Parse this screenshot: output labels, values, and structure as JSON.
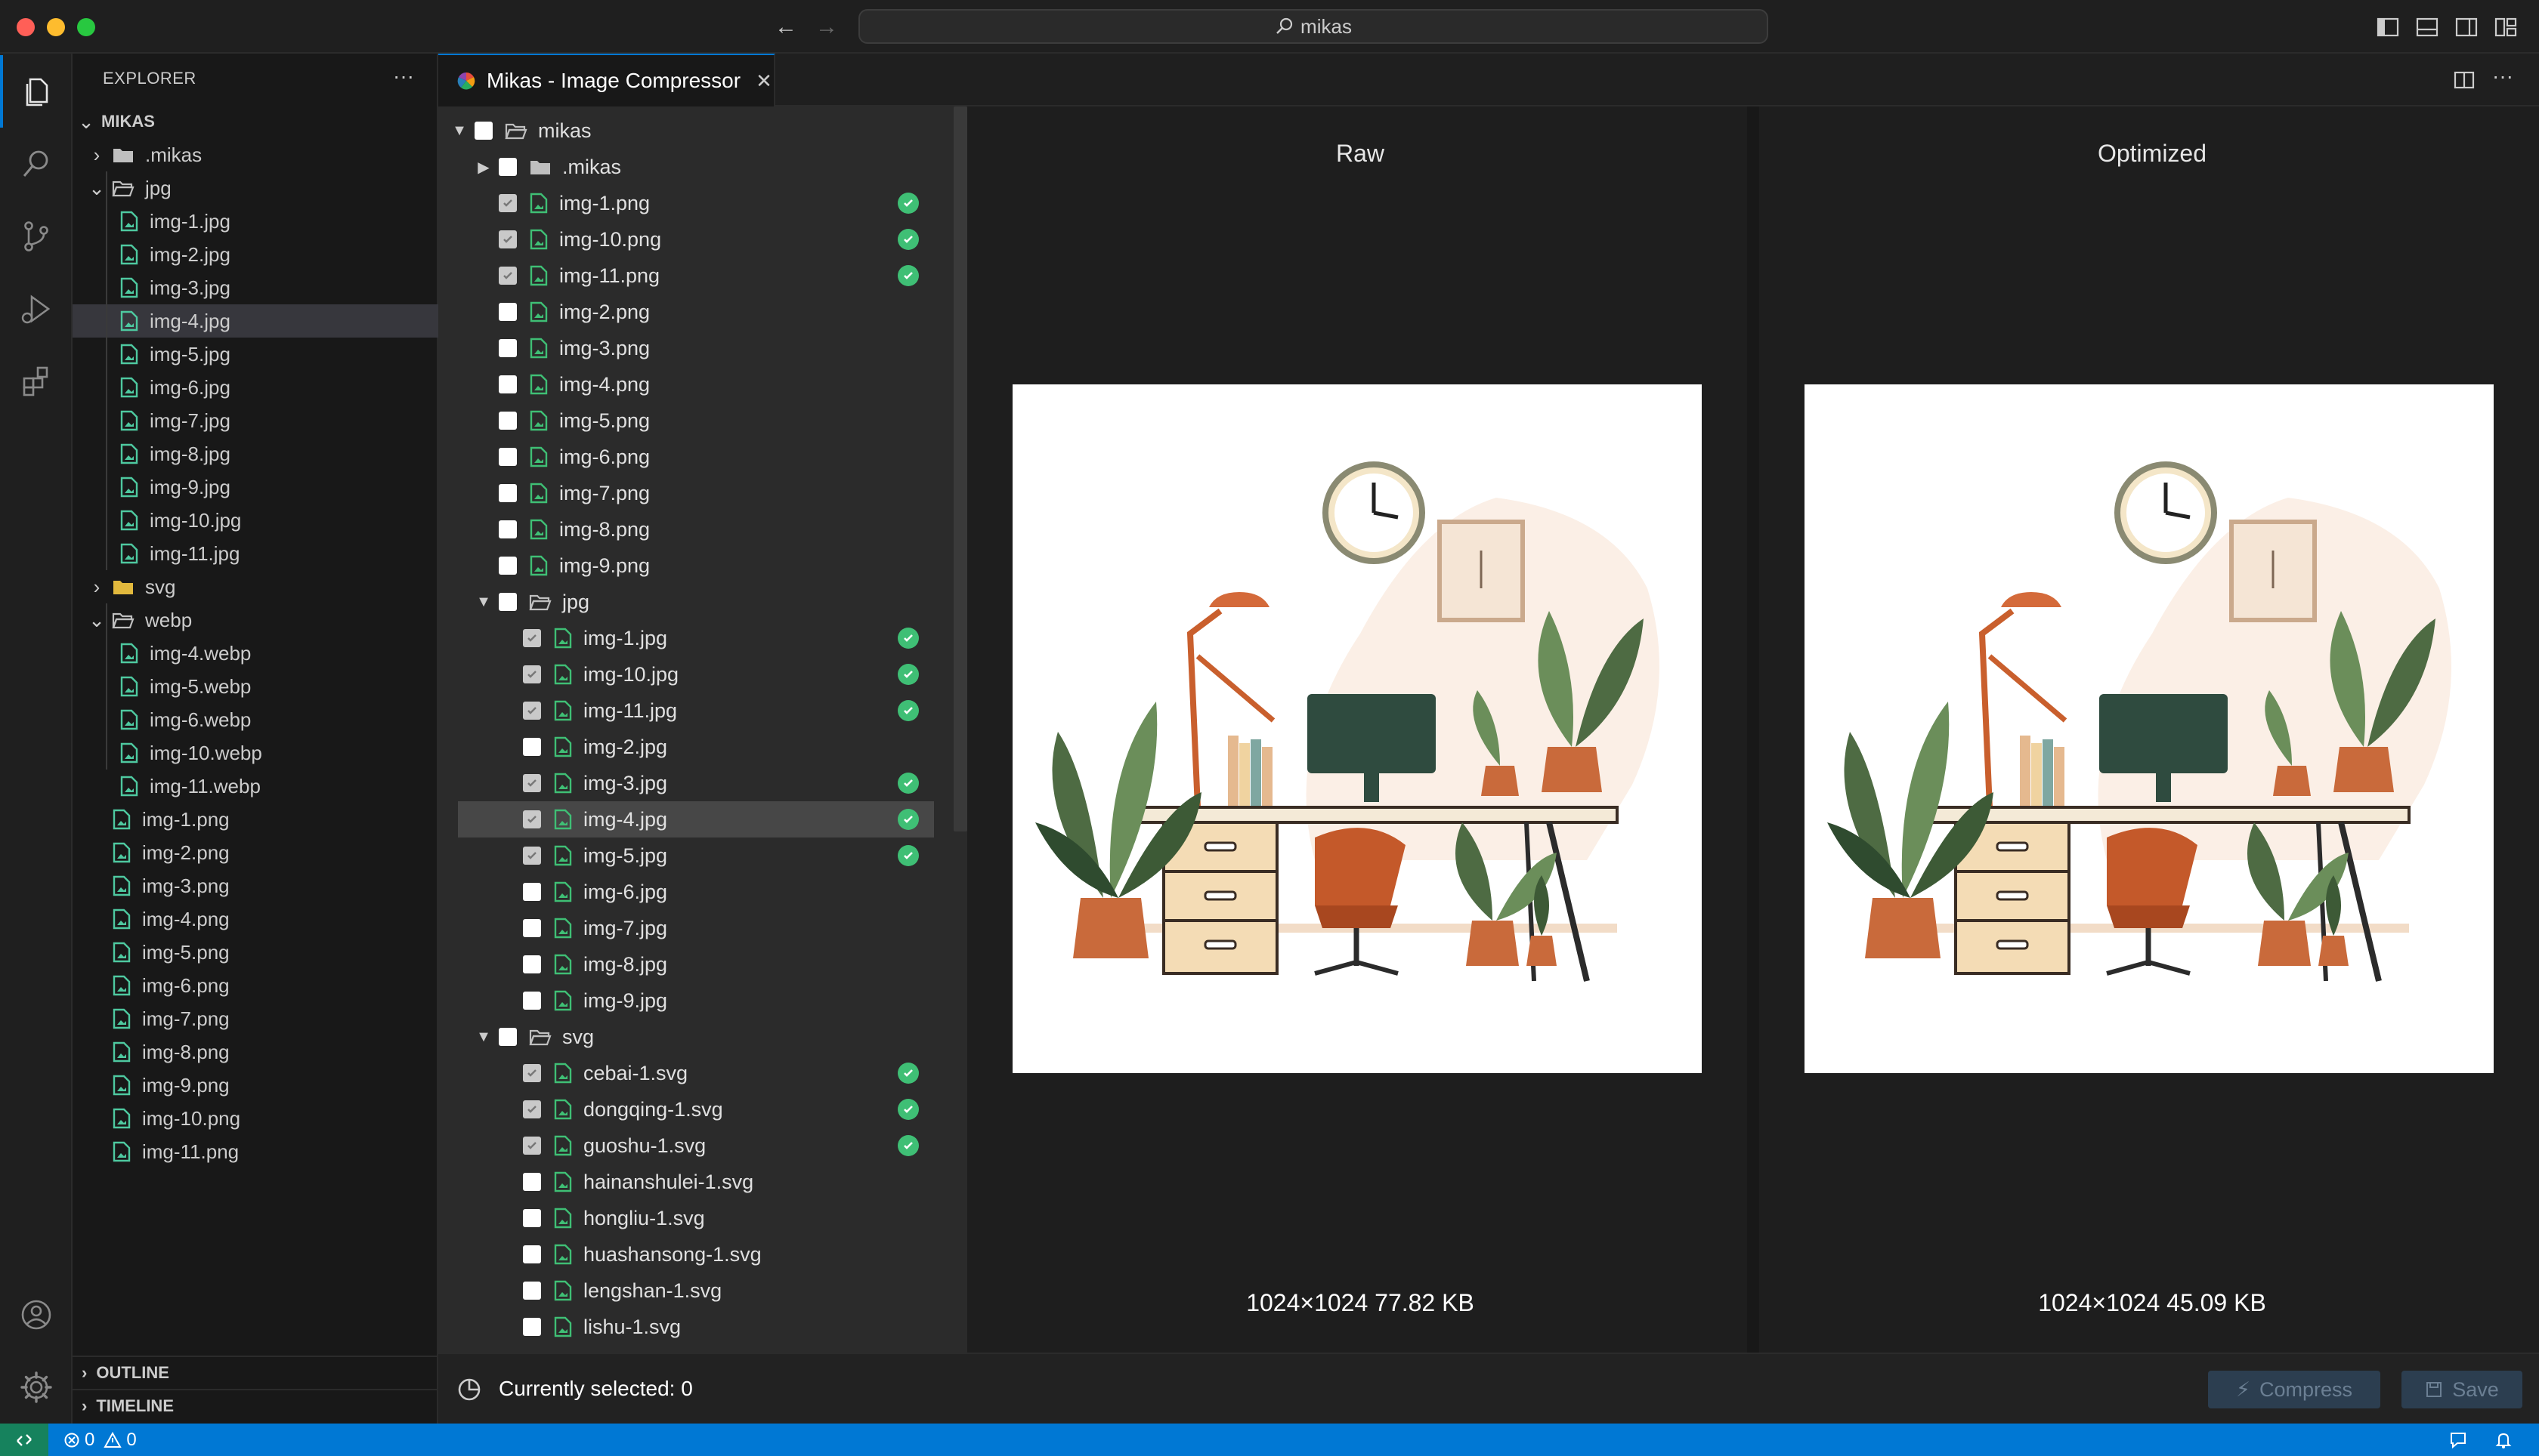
{
  "window": {
    "search_text": "mikas"
  },
  "sidebar": {
    "title": "EXPLORER",
    "root": "MIKAS",
    "items": [
      {
        "label": ".mikas",
        "kind": "folder",
        "depth": 1,
        "expanded": false
      },
      {
        "label": "jpg",
        "kind": "folder",
        "depth": 1,
        "expanded": true
      },
      {
        "label": "img-1.jpg",
        "kind": "file",
        "depth": 2
      },
      {
        "label": "img-2.jpg",
        "kind": "file",
        "depth": 2
      },
      {
        "label": "img-3.jpg",
        "kind": "file",
        "depth": 2
      },
      {
        "label": "img-4.jpg",
        "kind": "file",
        "depth": 2,
        "selected": true
      },
      {
        "label": "img-5.jpg",
        "kind": "file",
        "depth": 2
      },
      {
        "label": "img-6.jpg",
        "kind": "file",
        "depth": 2
      },
      {
        "label": "img-7.jpg",
        "kind": "file",
        "depth": 2
      },
      {
        "label": "img-8.jpg",
        "kind": "file",
        "depth": 2
      },
      {
        "label": "img-9.jpg",
        "kind": "file",
        "depth": 2
      },
      {
        "label": "img-10.jpg",
        "kind": "file",
        "depth": 2
      },
      {
        "label": "img-11.jpg",
        "kind": "file",
        "depth": 2
      },
      {
        "label": "svg",
        "kind": "folder",
        "depth": 1,
        "expanded": false,
        "yellow": true
      },
      {
        "label": "webp",
        "kind": "folder",
        "depth": 1,
        "expanded": true
      },
      {
        "label": "img-4.webp",
        "kind": "file",
        "depth": 2
      },
      {
        "label": "img-5.webp",
        "kind": "file",
        "depth": 2
      },
      {
        "label": "img-6.webp",
        "kind": "file",
        "depth": 2
      },
      {
        "label": "img-10.webp",
        "kind": "file",
        "depth": 2
      },
      {
        "label": "img-11.webp",
        "kind": "file",
        "depth": 2
      },
      {
        "label": "img-1.png",
        "kind": "file",
        "depth": 1
      },
      {
        "label": "img-2.png",
        "kind": "file",
        "depth": 1
      },
      {
        "label": "img-3.png",
        "kind": "file",
        "depth": 1
      },
      {
        "label": "img-4.png",
        "kind": "file",
        "depth": 1
      },
      {
        "label": "img-5.png",
        "kind": "file",
        "depth": 1
      },
      {
        "label": "img-6.png",
        "kind": "file",
        "depth": 1
      },
      {
        "label": "img-7.png",
        "kind": "file",
        "depth": 1
      },
      {
        "label": "img-8.png",
        "kind": "file",
        "depth": 1
      },
      {
        "label": "img-9.png",
        "kind": "file",
        "depth": 1
      },
      {
        "label": "img-10.png",
        "kind": "file",
        "depth": 1
      },
      {
        "label": "img-11.png",
        "kind": "file",
        "depth": 1
      }
    ],
    "outline": "OUTLINE",
    "timeline": "TIMELINE"
  },
  "editor": {
    "tab_title": "Mikas - Image Compressor",
    "files": [
      {
        "label": "mikas",
        "kind": "folder",
        "depth": 0,
        "expanded": true
      },
      {
        "label": ".mikas",
        "kind": "folder",
        "depth": 1,
        "expanded": false
      },
      {
        "label": "img-1.png",
        "kind": "file",
        "depth": 1,
        "checked": true,
        "done": true
      },
      {
        "label": "img-10.png",
        "kind": "file",
        "depth": 1,
        "checked": true,
        "done": true
      },
      {
        "label": "img-11.png",
        "kind": "file",
        "depth": 1,
        "checked": true,
        "done": true
      },
      {
        "label": "img-2.png",
        "kind": "file",
        "depth": 1
      },
      {
        "label": "img-3.png",
        "kind": "file",
        "depth": 1
      },
      {
        "label": "img-4.png",
        "kind": "file",
        "depth": 1
      },
      {
        "label": "img-5.png",
        "kind": "file",
        "depth": 1
      },
      {
        "label": "img-6.png",
        "kind": "file",
        "depth": 1
      },
      {
        "label": "img-7.png",
        "kind": "file",
        "depth": 1
      },
      {
        "label": "img-8.png",
        "kind": "file",
        "depth": 1
      },
      {
        "label": "img-9.png",
        "kind": "file",
        "depth": 1
      },
      {
        "label": "jpg",
        "kind": "folder",
        "depth": 1,
        "expanded": true
      },
      {
        "label": "img-1.jpg",
        "kind": "file",
        "depth": 2,
        "checked": true,
        "done": true
      },
      {
        "label": "img-10.jpg",
        "kind": "file",
        "depth": 2,
        "checked": true,
        "done": true
      },
      {
        "label": "img-11.jpg",
        "kind": "file",
        "depth": 2,
        "checked": true,
        "done": true
      },
      {
        "label": "img-2.jpg",
        "kind": "file",
        "depth": 2
      },
      {
        "label": "img-3.jpg",
        "kind": "file",
        "depth": 2,
        "checked": true,
        "done": true
      },
      {
        "label": "img-4.jpg",
        "kind": "file",
        "depth": 2,
        "checked": true,
        "done": true,
        "selected": true
      },
      {
        "label": "img-5.jpg",
        "kind": "file",
        "depth": 2,
        "checked": true,
        "done": true
      },
      {
        "label": "img-6.jpg",
        "kind": "file",
        "depth": 2
      },
      {
        "label": "img-7.jpg",
        "kind": "file",
        "depth": 2
      },
      {
        "label": "img-8.jpg",
        "kind": "file",
        "depth": 2
      },
      {
        "label": "img-9.jpg",
        "kind": "file",
        "depth": 2
      },
      {
        "label": "svg",
        "kind": "folder",
        "depth": 1,
        "expanded": true
      },
      {
        "label": "cebai-1.svg",
        "kind": "file",
        "depth": 2,
        "checked": true,
        "done": true
      },
      {
        "label": "dongqing-1.svg",
        "kind": "file",
        "depth": 2,
        "checked": true,
        "done": true
      },
      {
        "label": "guoshu-1.svg",
        "kind": "file",
        "depth": 2,
        "checked": true,
        "done": true
      },
      {
        "label": "hainanshulei-1.svg",
        "kind": "file",
        "depth": 2
      },
      {
        "label": "hongliu-1.svg",
        "kind": "file",
        "depth": 2
      },
      {
        "label": "huashansong-1.svg",
        "kind": "file",
        "depth": 2
      },
      {
        "label": "lengshan-1.svg",
        "kind": "file",
        "depth": 2
      },
      {
        "label": "lishu-1.svg",
        "kind": "file",
        "depth": 2
      }
    ],
    "raw": {
      "title": "Raw",
      "info": "1024×1024 77.82 KB"
    },
    "optimized": {
      "title": "Optimized",
      "info": "1024×1024 45.09 KB"
    },
    "selected_text": "Currently selected: 0",
    "compress_label": "Compress",
    "save_label": "Save"
  },
  "statusbar": {
    "errors": "0",
    "warnings": "0"
  },
  "colors": {
    "accent": "#0078d4",
    "success": "#3fbf75",
    "remote": "#16825d"
  }
}
